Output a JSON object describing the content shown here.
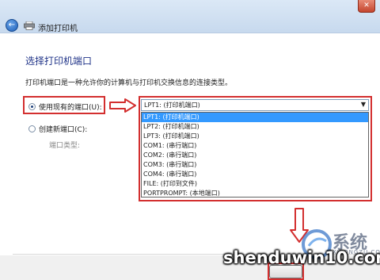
{
  "titlebar": {
    "title": "添加打印机",
    "close_label": "✕"
  },
  "icons": {
    "back": "back-arrow-icon",
    "printer": "printer-icon",
    "combo_arrow": "▼"
  },
  "page": {
    "heading": "选择打印机端口",
    "description": "打印机端口是一种允许你的计算机与打印机交换信息的连接类型。"
  },
  "options": {
    "use_existing": {
      "label": "使用现有的端口(U):",
      "checked": true
    },
    "create_new": {
      "label": "创建新端口(C):",
      "checked": false
    },
    "port_type_label": "端口类型:"
  },
  "dropdown": {
    "selected": "LPT1: (打印机端口)",
    "items": [
      "LPT1: (打印机端口)",
      "LPT2: (打印机端口)",
      "LPT3: (打印机端口)",
      "COM1: (串行端口)",
      "COM2: (串行端口)",
      "COM3: (串行端口)",
      "COM4: (串行端口)",
      "FILE: (打印到文件)",
      "PORTPROMPT: (本地端口)"
    ],
    "highlighted_index": 0
  },
  "colors": {
    "annotation_red": "#d32f2f",
    "heading_blue": "#1e3287",
    "selection_blue": "#3399ff"
  },
  "watermark": {
    "text": "shenduwin10.com",
    "brand": "系统",
    "small": "XITONGZU.COM"
  }
}
